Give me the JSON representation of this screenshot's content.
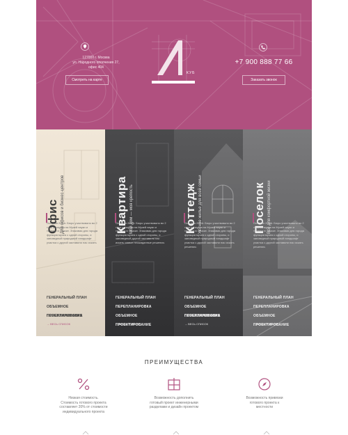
{
  "header": {
    "address_line1": "127000 г. Москва",
    "address_line2": "ул. Народного ополчения 27,",
    "address_line3": "офис 404",
    "map_button": "Смотреть на карте",
    "phone": "+7 900 888 77 66",
    "call_button": "Заказать звонок",
    "logo_letters": "КУБ",
    "brand_color": "#b0507f"
  },
  "categories": [
    {
      "title": "Офис",
      "subtitle": "Для офисов и бизнес-центров",
      "description": "Основан 2014г. Бюро участвовало во 2 туре конкурса на Музей науки и техники в Томске. Знаковая для города функция музея с одной стороны, и заповедный природный ландшафт участка с другой заставили нас искать",
      "links": [
        "ГЕНЕРАЛЬНЫЙ ПЛАН",
        "ОБЪЕМНОЕ ПРОЕКТИРОВАНИЕ",
        "ПЕРЕПЛАНИРОВКА"
      ],
      "more": "→ ВЕСЬ СПИСОК"
    },
    {
      "title": "Квартира",
      "subtitle": "Мой дом — моя крепость",
      "description": "Основан 2014г. Бюро участвовало во 2 туре конкурса на Музей науки и техники в Томске. Знаковая для города функция музея с одной стороны, и заповедный другой заставили нас искать самые неожиданные решения.",
      "links": [
        "ГЕНЕРАЛЬНЫЙ ПЛАН",
        "ПЕРЕПЛАНИРОВКА",
        "ОБЪЕМНОЕ ПРОЕКТИРОВАНИЕ"
      ],
      "more": "→ ВЕСЬ СПИСОК"
    },
    {
      "title": "Коттедж",
      "subtitle": "Уютное жилье для всей семьи",
      "description": "Основан 2014г. Бюро участвовало во 2 туре конкурса на Музей науки и техники в Томске. Знаковая для города функция музея с одной стороны, и заповедный природный ландшафт участка с другой заставили нас искать решения.",
      "links": [
        "ГЕНЕРАЛЬНЫЙ ПЛАН",
        "ОБЪЕМНОЕ ПРОЕКТИРОВАНИЕ",
        "ПЕРЕПЛАНИРОВКА"
      ],
      "more": "→ ВЕСЬ СПИСОК"
    },
    {
      "title": "Поселок",
      "subtitle": "Все для комфортной жизни",
      "description": "Основан 2014г. Бюро участвовало во 2 туре конкурса на Музей науки и техники в Томске. Знаковая для города функция музея с одной стороны, и заповедный природный ландшафт участка с другой заставили нас искать решения.",
      "links": [
        "ГЕНЕРАЛЬНЫЙ ПЛАН",
        "ПЕРЕПЛАНИРОВКА",
        "ОБЪЕМНОЕ ПРОЕКТИРОВАНИЕ"
      ],
      "more": "→ ВЕСЬ СПИСОК"
    }
  ],
  "advantages": {
    "title": "ПРЕИМУЩЕСТВА",
    "items": [
      {
        "icon": "percent-icon",
        "text_line1": "Низкая стоимость.",
        "text_line2": "Стоимость готового проекта",
        "text_line3": "составляет 20% от стоимости",
        "text_line4": "индивидуального проекта"
      },
      {
        "icon": "plan-icon",
        "text_line1": "Возможность дополнить",
        "text_line2": "готовый проект инженерными",
        "text_line3": "разделами и дизайн проектом",
        "text_line4": ""
      },
      {
        "icon": "compass-icon",
        "text_line1": "Возможность привязки",
        "text_line2": "готового проекта к",
        "text_line3": "местности",
        "text_line4": ""
      }
    ]
  }
}
